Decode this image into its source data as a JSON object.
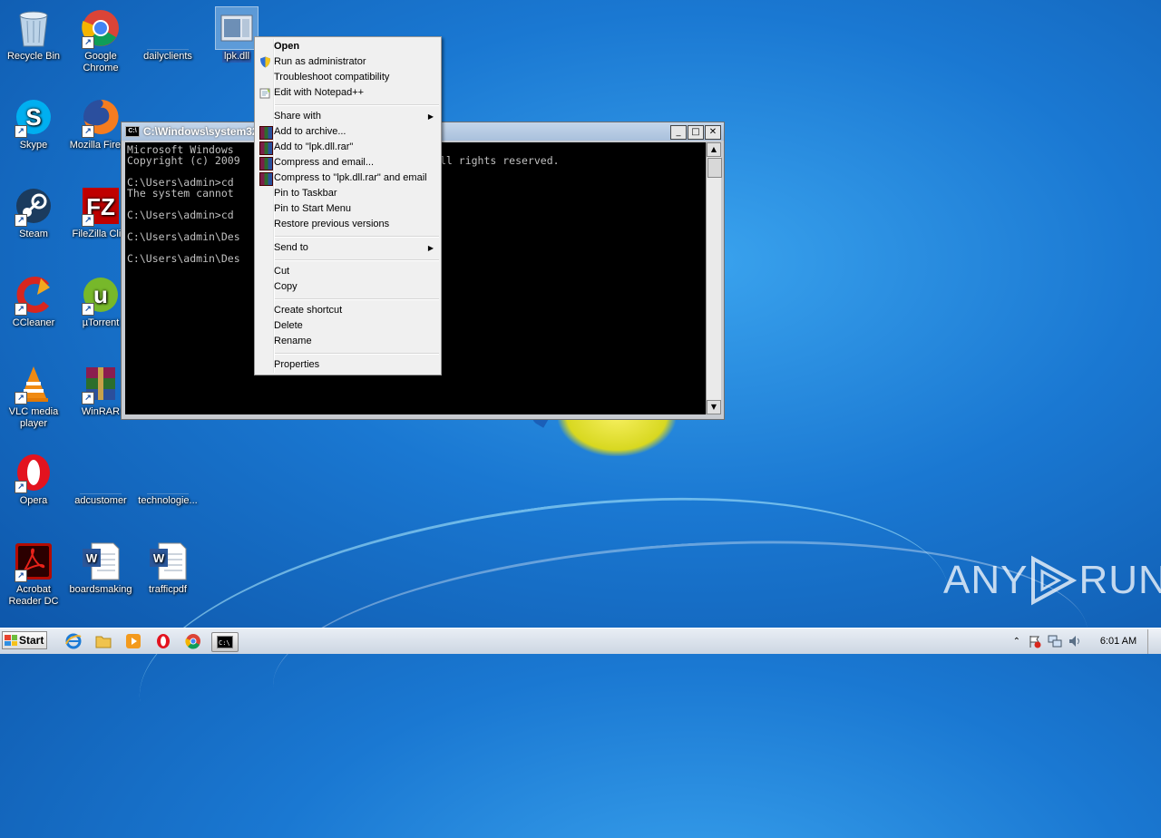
{
  "desktop": {
    "icons": [
      {
        "label": "Recycle Bin",
        "icon": "recycle-bin-icon"
      },
      {
        "label": "Google Chrome",
        "icon": "chrome-icon"
      },
      {
        "label": "dailyclients",
        "icon": "blank-file-icon"
      },
      {
        "label": "lpk.dll",
        "icon": "dll-file-icon"
      },
      {
        "label": "Skype",
        "icon": "skype-icon"
      },
      {
        "label": "Mozilla Firef...",
        "icon": "firefox-icon"
      },
      {
        "label": "Steam",
        "icon": "steam-icon"
      },
      {
        "label": "FileZilla Cli...",
        "icon": "filezilla-icon"
      },
      {
        "label": "CCleaner",
        "icon": "ccleaner-icon"
      },
      {
        "label": "µTorrent",
        "icon": "utorrent-icon"
      },
      {
        "label": "VLC media player",
        "icon": "vlc-icon"
      },
      {
        "label": "WinRAR",
        "icon": "winrar-icon"
      },
      {
        "label": "Opera",
        "icon": "opera-icon"
      },
      {
        "label": "adcustomer",
        "icon": "blank-file-icon"
      },
      {
        "label": "technologie...",
        "icon": "blank-file-icon"
      },
      {
        "label": "Acrobat Reader DC",
        "icon": "acrobat-icon"
      },
      {
        "label": "boardsmaking",
        "icon": "word-doc-icon"
      },
      {
        "label": "trafficpdf",
        "icon": "word-doc-icon"
      }
    ]
  },
  "cmd": {
    "title": "C:\\Windows\\system32",
    "lines": [
      "Microsoft Windows",
      "Copyright (c) 2009",
      "",
      "C:\\Users\\admin>cd",
      "The system cannot",
      "",
      "C:\\Users\\admin>cd",
      "",
      "C:\\Users\\admin\\Des",
      "",
      "C:\\Users\\admin\\Des"
    ],
    "right_text": "ll rights reserved."
  },
  "context_menu": {
    "items": [
      {
        "label": "Open",
        "bold": true
      },
      {
        "label": "Run as administrator",
        "icon": "shield-icon"
      },
      {
        "label": "Troubleshoot compatibility"
      },
      {
        "label": "Edit with Notepad++",
        "icon": "notepadpp-icon"
      },
      {
        "label": "Share with",
        "submenu": true
      },
      {
        "label": "Add to archive...",
        "icon": "winrar-icon"
      },
      {
        "label": "Add to \"lpk.dll.rar\"",
        "icon": "winrar-icon"
      },
      {
        "label": "Compress and email...",
        "icon": "winrar-icon"
      },
      {
        "label": "Compress to \"lpk.dll.rar\" and email",
        "icon": "winrar-icon"
      },
      {
        "label": "Pin to Taskbar"
      },
      {
        "label": "Pin to Start Menu"
      },
      {
        "label": "Restore previous versions"
      },
      {
        "label": "Send to",
        "submenu": true
      },
      {
        "label": "Cut"
      },
      {
        "label": "Copy"
      },
      {
        "label": "Create shortcut"
      },
      {
        "label": "Delete"
      },
      {
        "label": "Rename"
      },
      {
        "label": "Properties"
      }
    ]
  },
  "taskbar": {
    "start_label": "Start",
    "clock": "6:01 AM",
    "pinned": [
      "ie-icon",
      "explorer-icon",
      "media-player-icon",
      "opera-icon",
      "chrome-icon",
      "cmd-icon"
    ]
  },
  "watermark": {
    "left": "ANY",
    "right": "RUN"
  }
}
